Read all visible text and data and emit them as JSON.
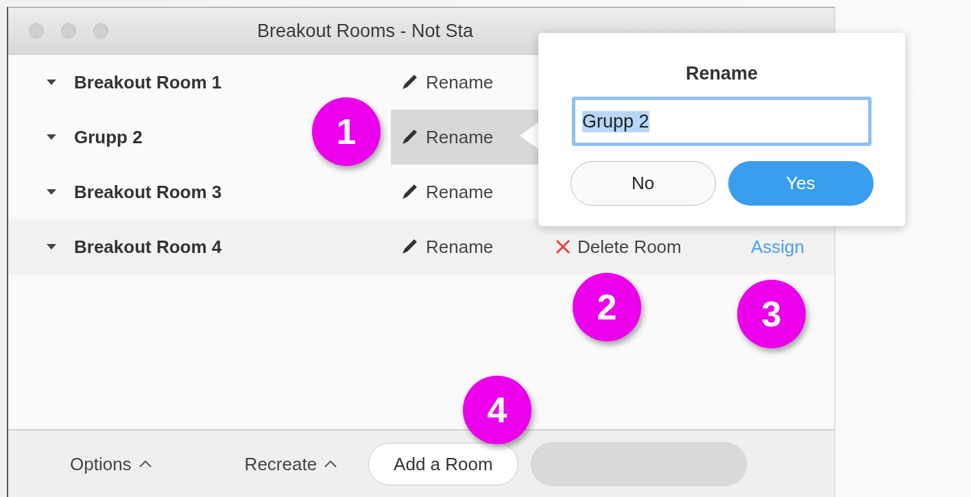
{
  "window": {
    "title": "Breakout Rooms - Not Sta"
  },
  "rooms": [
    {
      "name": "Breakout Room 1",
      "rename": "Rename",
      "rename_highlighted": false
    },
    {
      "name": "Grupp 2",
      "rename": "Rename",
      "rename_highlighted": true
    },
    {
      "name": "Breakout Room 3",
      "rename": "Rename",
      "rename_highlighted": false
    },
    {
      "name": "Breakout Room 4",
      "rename": "Rename",
      "rename_highlighted": false,
      "delete": "Delete Room",
      "assign": "Assign"
    }
  ],
  "popover": {
    "title": "Rename",
    "value": "Grupp 2",
    "no": "No",
    "yes": "Yes"
  },
  "footer": {
    "options": "Options",
    "recreate": "Recreate",
    "add_room": "Add a Room",
    "last_button_disabled": true
  },
  "callouts": [
    "1",
    "2",
    "3",
    "4"
  ]
}
